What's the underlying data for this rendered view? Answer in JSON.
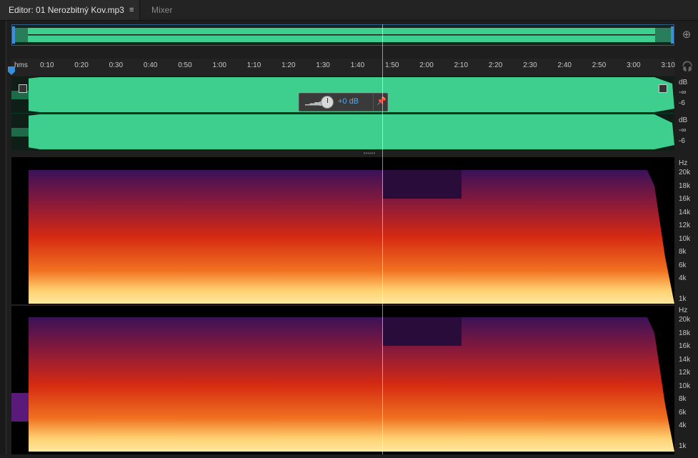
{
  "tabs": {
    "editor_label": "Editor: 01 Nerozbitný Kov.mp3",
    "menu_glyph": "≡",
    "mixer_label": "Mixer"
  },
  "ruler": {
    "unit_label": "hms",
    "ticks": [
      "0:10",
      "0:20",
      "0:30",
      "0:40",
      "0:50",
      "1:00",
      "1:10",
      "1:20",
      "1:30",
      "1:40",
      "1:50",
      "2:00",
      "2:10",
      "2:20",
      "2:30",
      "2:40",
      "2:50",
      "3:00",
      "3:10"
    ]
  },
  "db_scale": {
    "labels": [
      "dB",
      "-∞",
      "-6",
      "dB",
      "-∞",
      "-6"
    ]
  },
  "hud": {
    "value": "+0 dB"
  },
  "hz_scale": {
    "top_labels": [
      "Hz",
      "20k",
      "18k",
      "16k",
      "14k",
      "12k",
      "10k",
      "8k",
      "6k",
      "4k",
      "1k"
    ],
    "bottom_labels": [
      "Hz",
      "20k",
      "18k",
      "16k",
      "14k",
      "12k",
      "10k",
      "8k",
      "6k",
      "4k",
      "1k"
    ]
  },
  "icons": {
    "zoom": "zoom-icon",
    "headphones": "headphones-icon",
    "pin": "pin-icon",
    "knob": "volume-knob-icon"
  },
  "colors": {
    "waveform": "#3ecf8e",
    "accent": "#3b8fd9",
    "spectral_hot": "#ffe080",
    "spectral_mid": "#e03010",
    "spectral_low": "#4a1a6a"
  }
}
